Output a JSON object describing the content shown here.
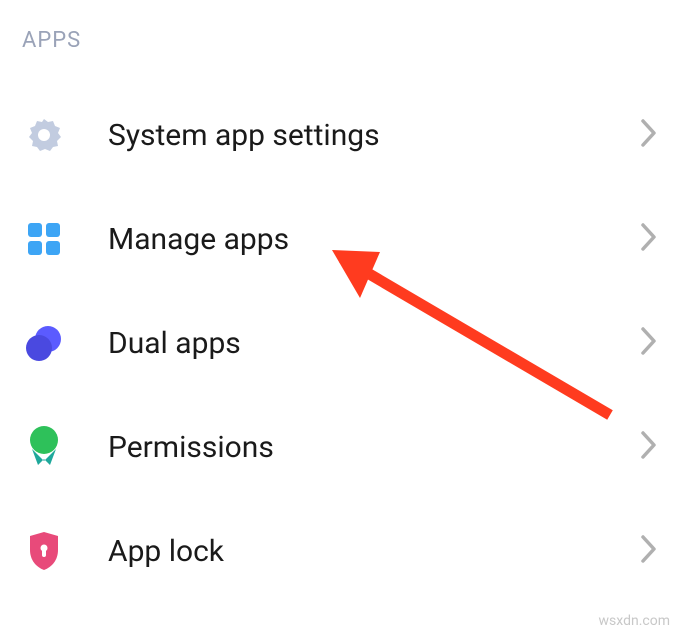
{
  "section": {
    "title": "APPS"
  },
  "items": [
    {
      "label": "System app settings",
      "icon": "gear"
    },
    {
      "label": "Manage apps",
      "icon": "grid"
    },
    {
      "label": "Dual apps",
      "icon": "dual-circles"
    },
    {
      "label": "Permissions",
      "icon": "permissions-badge"
    },
    {
      "label": "App lock",
      "icon": "shield-lock"
    }
  ],
  "watermark": "wsxdn.com",
  "colors": {
    "header_text": "#9aa3b8",
    "gear": "#c2cce0",
    "grid": "#3da5f5",
    "dual": "#5b5bff",
    "permission_circle": "#2ec15a",
    "permission_ribbon": "#1ea89b",
    "shield": "#e84a7a",
    "arrow": "#ff3b1f",
    "chevron": "#b0b0b0"
  }
}
